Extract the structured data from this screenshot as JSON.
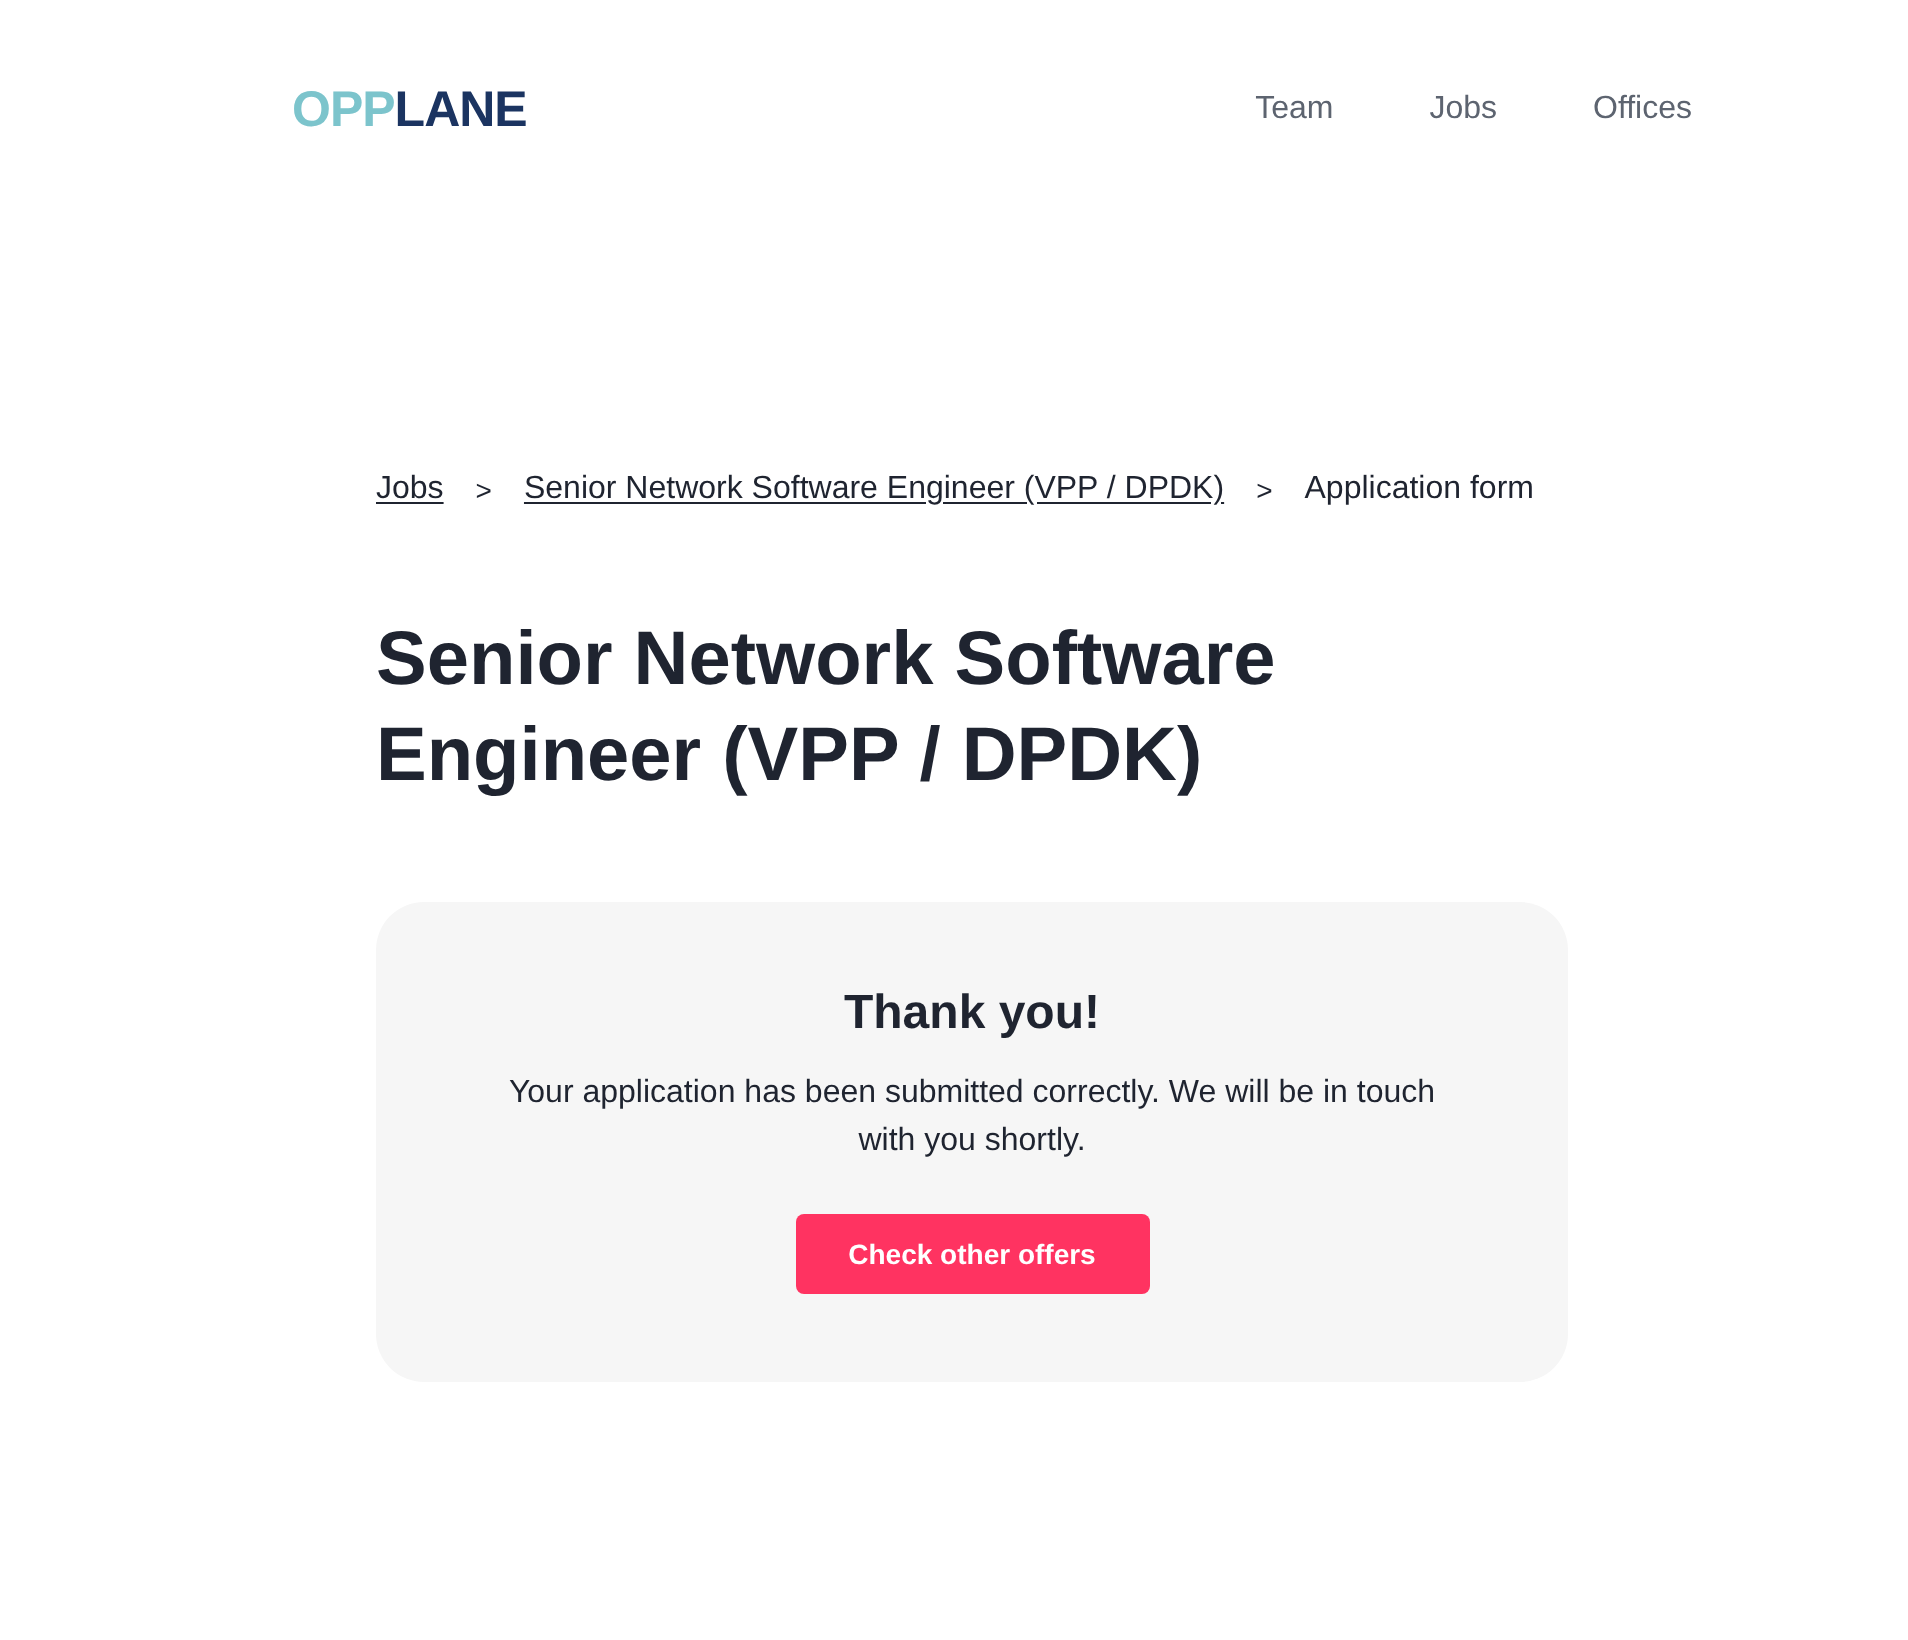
{
  "header": {
    "logo": {
      "accent": "OPP",
      "main": "LANE"
    },
    "nav_links": [
      "Team",
      "Jobs",
      "Offices"
    ]
  },
  "breadcrumb": [
    {
      "kind": "link",
      "label": "Jobs"
    },
    {
      "kind": "separator",
      "label": ">"
    },
    {
      "kind": "link",
      "label": "Senior Network Software Engineer (VPP / DPDK)"
    },
    {
      "kind": "separator",
      "label": ">"
    },
    {
      "kind": "current",
      "label": "Application form"
    }
  ],
  "page_title": "Senior Network Software Engineer (VPP / DPDK)",
  "confirmation": {
    "title": "Thank you!",
    "message": "Your application has been submitted correctly. We will be in touch with you shortly.",
    "button": "Check other offers"
  }
}
